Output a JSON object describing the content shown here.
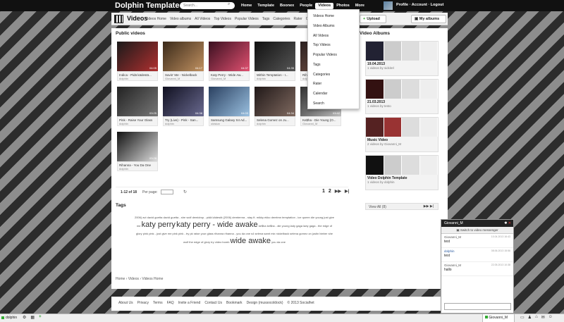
{
  "topbar": {
    "logo": "Dolphin Template",
    "search_placeholder": "Search...",
    "menu": [
      "Home",
      "Template",
      "Boonex",
      "People",
      "Videos",
      "Photos",
      "More"
    ],
    "active_menu": "Videos",
    "profile_links": "Profile · Account · Logout"
  },
  "header": {
    "title": "Videos",
    "submenu": [
      "Videos Home",
      "Video albums",
      "All Videos",
      "Top Videos",
      "Popular Videos",
      "Tags",
      "Categories",
      "Rater",
      "C"
    ],
    "upload_label": "Upload",
    "myalbums_label": "My albums"
  },
  "dropdown": [
    "Videos Home",
    "Video Albums",
    "All Videos",
    "Top Videos",
    "Popular Videos",
    "Tags",
    "Categories",
    "Rater",
    "Calendar",
    "Search"
  ],
  "public_videos": {
    "title": "Public videos",
    "items": [
      {
        "title": "Indica - Pidä kädestä...",
        "author": "dolphin",
        "duration": "04:05",
        "colors": [
          "#1a1a1a",
          "#b03030"
        ]
      },
      {
        "title": "Savin' Me - Nickelback",
        "author": "Giovanni_M",
        "duration": "04:17",
        "colors": [
          "#3a2a1a",
          "#c09060"
        ]
      },
      {
        "title": "Katy Perry - Wide Aw...",
        "author": "Giovanni_M",
        "duration": "04:37",
        "colors": [
          "#3a1020",
          "#e05070"
        ]
      },
      {
        "title": "Within Temptation - I...",
        "author": "dolphin",
        "duration": "04:35",
        "colors": [
          "#111",
          "#555"
        ]
      },
      {
        "title": "Rihanna - Stay ft. Mik...",
        "author": "dolphin",
        "duration": "04:22",
        "colors": [
          "#2a2020",
          "#8a6050"
        ]
      },
      {
        "title": "Pink - Raise Your Glass",
        "author": "dolphin",
        "duration": "03:25",
        "colors": [
          "#222",
          "#777"
        ]
      },
      {
        "title": "Try (Live) - Pink - San...",
        "author": "dolphin",
        "duration": "04:38",
        "colors": [
          "#101020",
          "#6a6a90"
        ]
      },
      {
        "title": "Samsung Galaxy S4 Ad...",
        "author": "oldskar",
        "duration": "04:03",
        "colors": [
          "#2a4060",
          "#9ac0e0"
        ]
      },
      {
        "title": "Selena Gomez on Ju...",
        "author": "dolphin",
        "duration": "04:34",
        "colors": [
          "#201818",
          "#806a60"
        ]
      },
      {
        "title": "Ke$ha - Die Young (O...",
        "author": "Giovanni_M",
        "duration": "03:42",
        "colors": [
          "#303030",
          "#bbb"
        ]
      },
      {
        "title": "Rihanna - You Da One",
        "author": "dolphin",
        "duration": "03:28",
        "colors": [
          "#111",
          "#ddd"
        ]
      }
    ]
  },
  "pagination": {
    "count": "1-12 of 18",
    "per_page_label": "Per page:",
    "per_page_value": "",
    "pages": [
      "1",
      "2"
    ],
    "arrows": [
      "▶▶",
      "▶|"
    ]
  },
  "tags": {
    "title": "Tags",
    "line1": "2006) avi  david guetta  david guetta - she wolf  demidrop - pidä kädestä (2006)  demtemra - stay ft. mikky ekko  demtmn temptation - ice queen  die young  just give",
    "line2a": "me",
    "big1": "katy perry",
    "big2": "katy perry - wide awake",
    "line2b": "ke$ha  ke$ha - die young  lady gaga  lady gaga - the edge of",
    "line3": "glory  pink  pink - just give me  pink  pink - try  pk raise your glass  rihanna  rihanna - you da one  s4  selena  samt mix  nickelback  selena gomez on justin bieber  she",
    "line4a": "wolf  the edge of glory  try  video bomb",
    "big3": "wide awake",
    "line4b": "you da one"
  },
  "breadcrumb": "Home  ›  Videos  ›  Videos Home",
  "albums": {
    "title": "Video Albums",
    "items": [
      {
        "title": "19.04.2013",
        "sub": "1 videos by sidcitel"
      },
      {
        "title": "21.03.2013",
        "sub": "1 videos by testo"
      },
      {
        "title": "Music Video",
        "sub": "2 videos by Giovanni_M"
      },
      {
        "title": "Video Dolphin Template",
        "sub": "1 videos by dolphin"
      }
    ],
    "view_all": "View All (8)"
  },
  "footer": {
    "links": [
      "About Us",
      "Privacy",
      "Terms",
      "FAQ",
      "Invite a Friend",
      "Contact Us",
      "Bookmark",
      "Design (mussocoldock)",
      "© 2013 Socialhet"
    ]
  },
  "chat": {
    "header": "Giovanni_M",
    "switch": "Switch to video messenger",
    "messages": [
      {
        "who": "Giovanni_M",
        "when": "10.04.2013 16:43",
        "text": "test",
        "me": false
      },
      {
        "who": "dolphin",
        "when": "08.06.2013 15:56",
        "text": "test",
        "me": true
      },
      {
        "who": "Giovanni_M",
        "when": "22.05.2013 10:38",
        "text": "hallo",
        "me": false
      }
    ]
  },
  "bottombar": {
    "user": "dolphin",
    "chat_user": "Giovanni_M"
  }
}
